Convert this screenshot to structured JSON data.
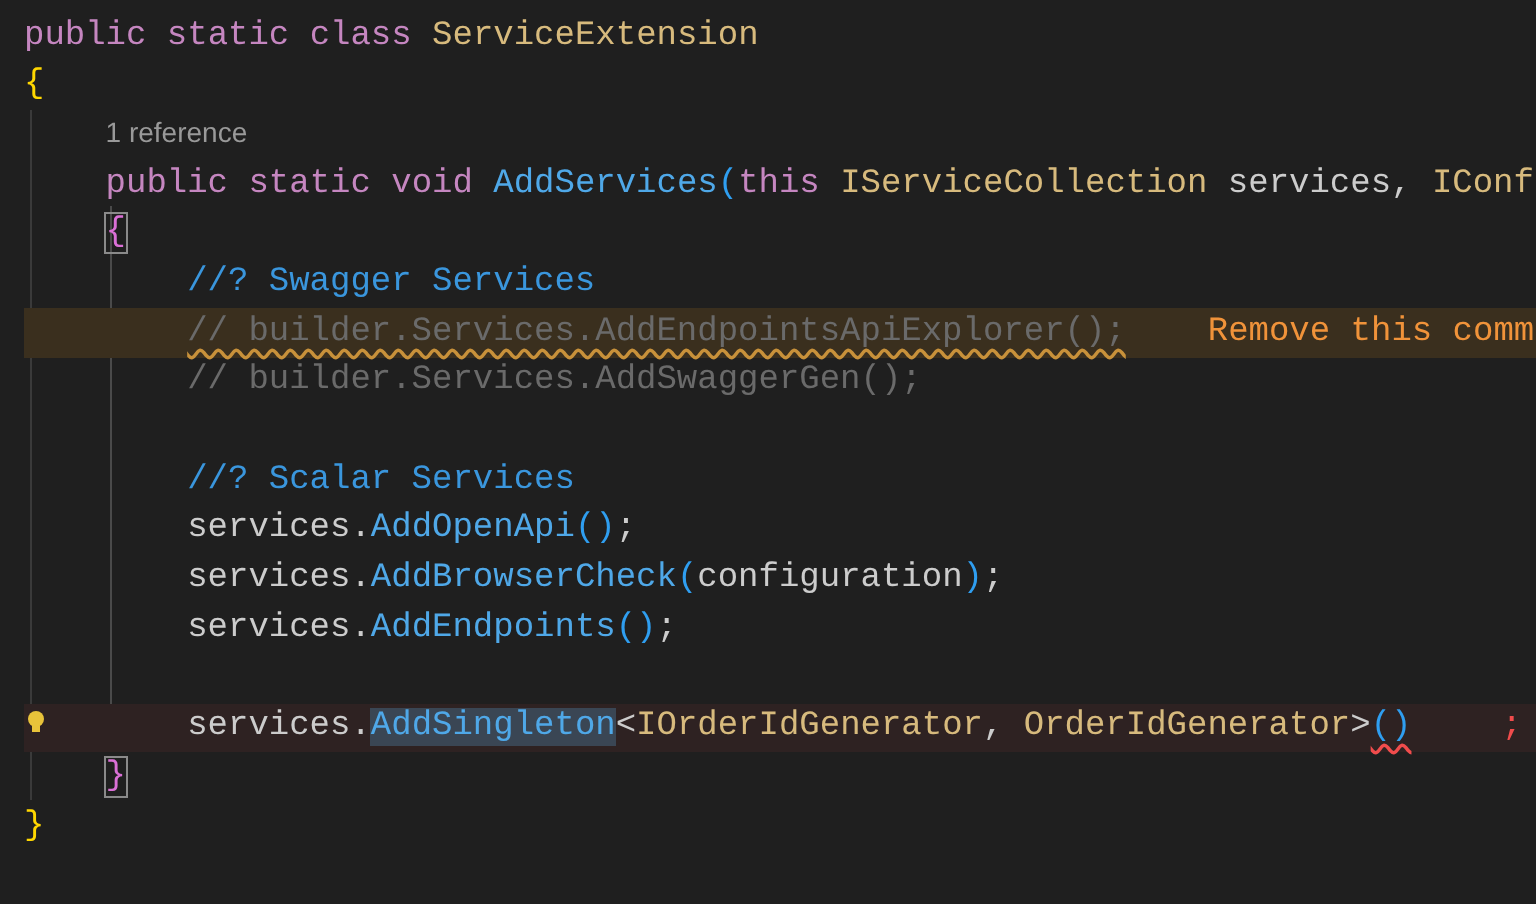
{
  "lines": [
    {
      "kind": "code",
      "tokens": [
        {
          "kind": "keyword",
          "text": "public static class "
        },
        {
          "kind": "type",
          "text": "ServiceExtension"
        }
      ]
    },
    {
      "kind": "code",
      "tokens": [
        {
          "kind": "brace",
          "text": "{"
        }
      ]
    },
    {
      "kind": "block",
      "children": [
        {
          "kind": "codelens",
          "tokens": [
            {
              "kind": "codelens",
              "text": "1 reference"
            }
          ]
        },
        {
          "kind": "code",
          "tokens": [
            {
              "kind": "keyword",
              "text": "public static void "
            },
            {
              "kind": "method",
              "text": "AddServices"
            },
            {
              "kind": "paren",
              "text": "("
            },
            {
              "kind": "keyword",
              "text": "this "
            },
            {
              "kind": "type",
              "text": "IServiceCollection"
            },
            {
              "kind": "plain",
              "text": " services, "
            },
            {
              "kind": "type",
              "text": "IConf"
            }
          ]
        },
        {
          "kind": "code",
          "tokens": [
            {
              "kind": "brace2",
              "text": "{",
              "matched": true
            }
          ]
        },
        {
          "kind": "block",
          "children": [
            {
              "kind": "code",
              "tokens": [
                {
                  "kind": "comment-mark",
                  "text": "//? Swagger Services"
                }
              ]
            },
            {
              "kind": "code",
              "warning": true,
              "tokens": [
                {
                  "kind": "comment",
                  "text": "// builder.Services.AddEndpointsApiExplorer();",
                  "squiggle": true
                }
              ],
              "hint": "Remove this comm"
            },
            {
              "kind": "code",
              "tokens": [
                {
                  "kind": "comment",
                  "text": "// builder.Services.AddSwaggerGen();"
                }
              ]
            },
            {
              "kind": "blank"
            },
            {
              "kind": "code",
              "tokens": [
                {
                  "kind": "comment-mark",
                  "text": "//? Scalar Services"
                }
              ]
            },
            {
              "kind": "code",
              "tokens": [
                {
                  "kind": "plain",
                  "text": "services."
                },
                {
                  "kind": "method",
                  "text": "AddOpenApi"
                },
                {
                  "kind": "paren",
                  "text": "()"
                },
                {
                  "kind": "plain",
                  "text": ";"
                }
              ]
            },
            {
              "kind": "code",
              "tokens": [
                {
                  "kind": "plain",
                  "text": "services."
                },
                {
                  "kind": "method",
                  "text": "AddBrowserCheck"
                },
                {
                  "kind": "paren",
                  "text": "("
                },
                {
                  "kind": "plain",
                  "text": "configuration"
                },
                {
                  "kind": "paren",
                  "text": ")"
                },
                {
                  "kind": "plain",
                  "text": ";"
                }
              ]
            },
            {
              "kind": "code",
              "tokens": [
                {
                  "kind": "plain",
                  "text": "services."
                },
                {
                  "kind": "method",
                  "text": "AddEndpoints"
                },
                {
                  "kind": "paren",
                  "text": "()"
                },
                {
                  "kind": "plain",
                  "text": ";"
                }
              ]
            },
            {
              "kind": "blank"
            },
            {
              "kind": "code",
              "error": true,
              "lightbulb": true,
              "tokens": [
                {
                  "kind": "plain",
                  "text": "services."
                },
                {
                  "kind": "method",
                  "text": "AddSingleton",
                  "selected": true
                },
                {
                  "kind": "plain",
                  "text": "<"
                },
                {
                  "kind": "type",
                  "text": "IOrderIdGenerator"
                },
                {
                  "kind": "plain",
                  "text": ", "
                },
                {
                  "kind": "type",
                  "text": "OrderIdGenerator"
                },
                {
                  "kind": "plain",
                  "text": ">"
                },
                {
                  "kind": "paren",
                  "text": "()",
                  "squiggle": true
                }
              ],
              "hint": ";"
            }
          ]
        },
        {
          "kind": "code",
          "tokens": [
            {
              "kind": "brace2",
              "text": "}",
              "matched": true
            }
          ]
        }
      ]
    },
    {
      "kind": "code",
      "tokens": [
        {
          "kind": "brace",
          "text": "}"
        }
      ]
    }
  ]
}
